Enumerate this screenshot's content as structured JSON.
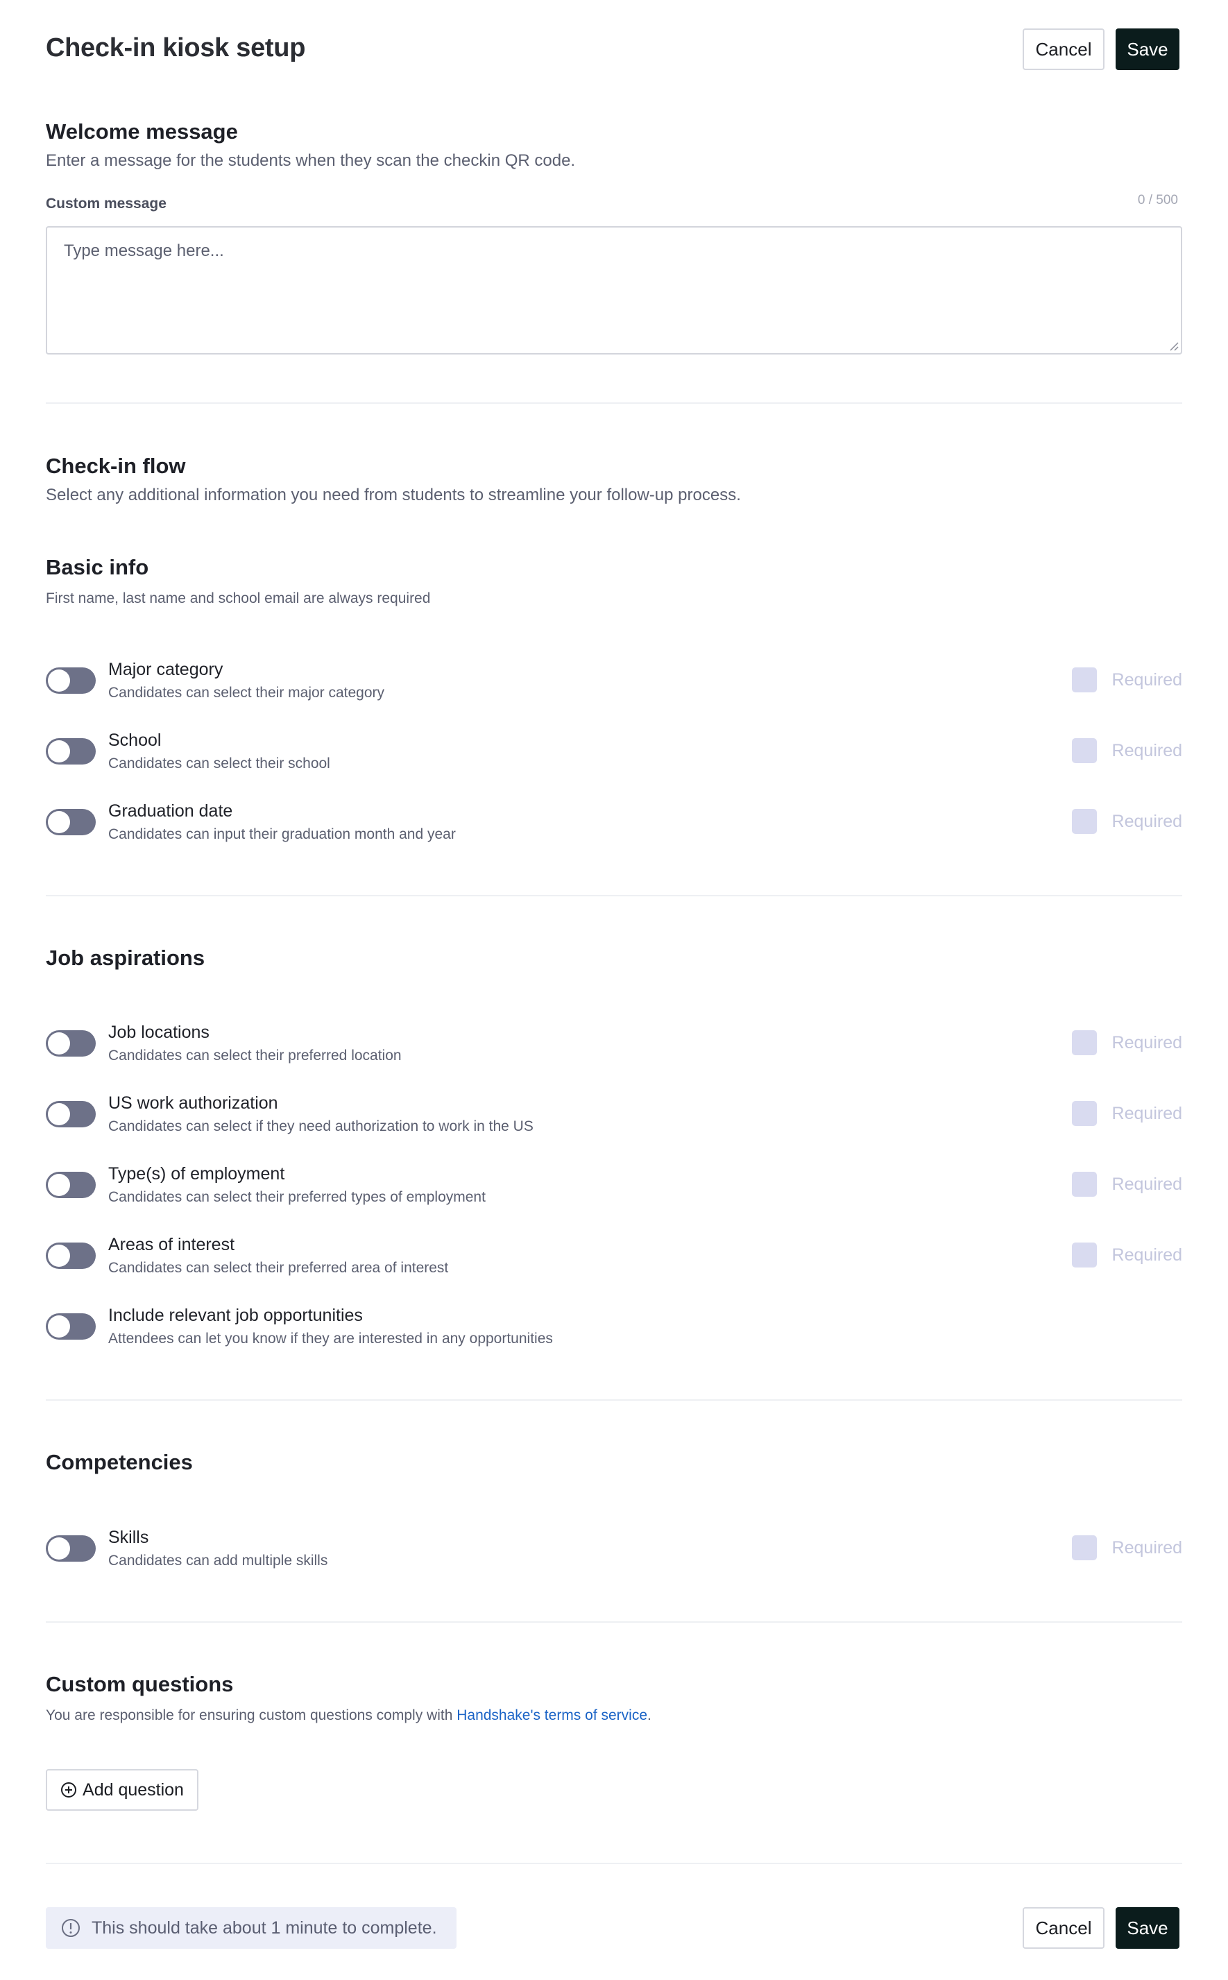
{
  "header": {
    "title": "Check-in kiosk setup",
    "cancel_label": "Cancel",
    "save_label": "Save"
  },
  "welcome": {
    "heading": "Welcome message",
    "description": "Enter a message for the students when they scan the checkin QR code.",
    "field_label": "Custom message",
    "counter": "0 / 500",
    "placeholder": "Type message here..."
  },
  "checkin_flow": {
    "heading": "Check-in flow",
    "description": "Select any additional information you need from students to streamline your follow-up process."
  },
  "basic_info": {
    "heading": "Basic info",
    "description": "First name, last name and school email are always required",
    "items": [
      {
        "label": "Major category",
        "description": "Candidates can select their major category",
        "required_label": "Required"
      },
      {
        "label": "School",
        "description": "Candidates can select their school",
        "required_label": "Required"
      },
      {
        "label": "Graduation date",
        "description": "Candidates can input their graduation month and year",
        "required_label": "Required"
      }
    ]
  },
  "job_aspirations": {
    "heading": "Job aspirations",
    "items": [
      {
        "label": "Job locations",
        "description": "Candidates can select their preferred location",
        "required_label": "Required"
      },
      {
        "label": "US work authorization",
        "description": "Candidates can select if they need authorization to work in the US",
        "required_label": "Required"
      },
      {
        "label": "Type(s) of employment",
        "description": "Candidates can select their preferred types of employment",
        "required_label": "Required"
      },
      {
        "label": "Areas of interest",
        "description": "Candidates can select their preferred area of interest",
        "required_label": "Required"
      },
      {
        "label": "Include relevant job opportunities",
        "description": "Attendees can let you know if they are interested in any opportunities"
      }
    ]
  },
  "competencies": {
    "heading": "Competencies",
    "items": [
      {
        "label": "Skills",
        "description": "Candidates can add multiple skills",
        "required_label": "Required"
      }
    ]
  },
  "custom_questions": {
    "heading": "Custom questions",
    "notice_prefix": "You are responsible for ensuring custom questions comply with ",
    "notice_link": "Handshake's terms of service",
    "notice_suffix": ".",
    "add_label": "Add question"
  },
  "footer": {
    "info": "This should take about 1 minute to complete.",
    "cancel_label": "Cancel",
    "save_label": "Save"
  },
  "colors": {
    "save_button": "#0b1c1c",
    "toggle_off": "#6d7188",
    "link": "#1a63c6",
    "info_banner": "#eceef8"
  }
}
